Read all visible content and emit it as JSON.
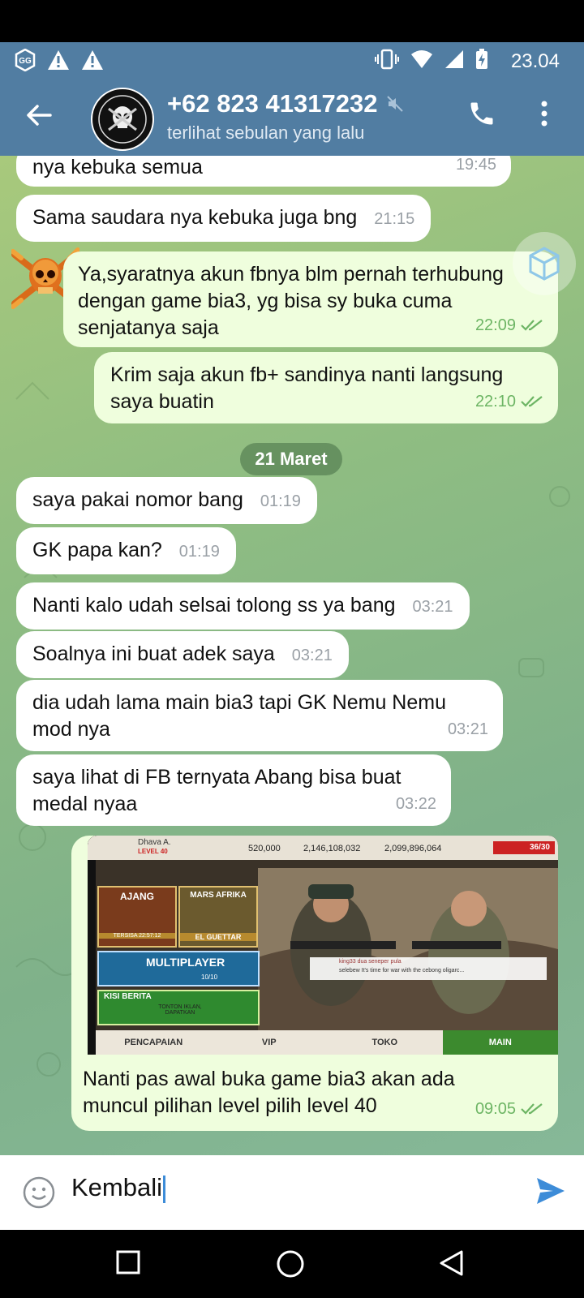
{
  "status_bar": {
    "time": "23.04",
    "left_icons": [
      "gg-icon",
      "warning-icon",
      "warning-icon"
    ],
    "right_icons": [
      "vibrate-icon",
      "wifi-icon",
      "signal-icon",
      "battery-charging-icon"
    ]
  },
  "header": {
    "contact_name": "+62 823 41317232",
    "last_seen": "terlihat sebulan yang lalu",
    "muted": true
  },
  "date_separator": "21 Maret",
  "messages": [
    {
      "dir": "in",
      "text": "nya kebuka semua",
      "time": "19:45"
    },
    {
      "dir": "in",
      "text": "Sama saudara nya kebuka juga bng",
      "time": "21:15"
    },
    {
      "dir": "out",
      "text": "Ya,syaratnya akun fbnya blm pernah terhubung dengan game bia3, yg bisa sy buka cuma senjatanya saja",
      "time": "22:09",
      "read": true
    },
    {
      "dir": "out",
      "text": "Krim saja akun fb+ sandinya nanti langsung saya buatin",
      "time": "22:10",
      "read": true
    },
    {
      "dir": "in",
      "text": "saya pakai nomor bang",
      "time": "01:19"
    },
    {
      "dir": "in",
      "text": "GK papa kan?",
      "time": "01:19"
    },
    {
      "dir": "in",
      "text": "Nanti kalo udah selsai tolong ss ya bang",
      "time": "03:21"
    },
    {
      "dir": "in",
      "text": "Soalnya ini buat adek saya",
      "time": "03:21"
    },
    {
      "dir": "in",
      "text": "dia udah lama main bia3 tapi GK Nemu Nemu mod nya",
      "time": "03:21"
    },
    {
      "dir": "in",
      "text": "saya lihat di FB ternyata Abang bisa buat medal nyaa",
      "time": "03:22"
    },
    {
      "dir": "out",
      "text": "Nanti pas awal buka game bia3 akan ada muncul pilihan level pilih level 40",
      "time": "09:05",
      "read": true
    }
  ],
  "game_screenshot": {
    "player_name": "Dhava A.",
    "level": "LEVEL 40",
    "stat_1": "520,000",
    "stat_2": "2,146,108,032",
    "stat_3": "2,099,896,064",
    "energy": "36/30",
    "tile_1": "AJANG",
    "tile_1_sub": "TERSISA 22:57:12",
    "tile_2": "MARS AFRIKA",
    "tile_2_sub": "EL GUETTAR",
    "multiplayer": "MULTIPLAYER",
    "multiplayer_count": "10/10",
    "news_title": "KISI BERITA",
    "news_sub": "TONTON IKLAN, DAPATKAN",
    "chat_line_1": "king33  dua seneper pula",
    "chat_line_2": "selebew   It's time for war with the cebong oligarc...",
    "tabs": [
      "PENCAPAIAN",
      "VIP",
      "TOKO",
      "MAIN"
    ]
  },
  "input": {
    "value": "Kembali"
  },
  "nav": [
    "recent-apps",
    "home",
    "back"
  ],
  "colors": {
    "header": "#517da2",
    "incoming": "#ffffff",
    "outgoing": "#effedd",
    "out_time": "#6db564",
    "send": "#3d8cd8"
  }
}
